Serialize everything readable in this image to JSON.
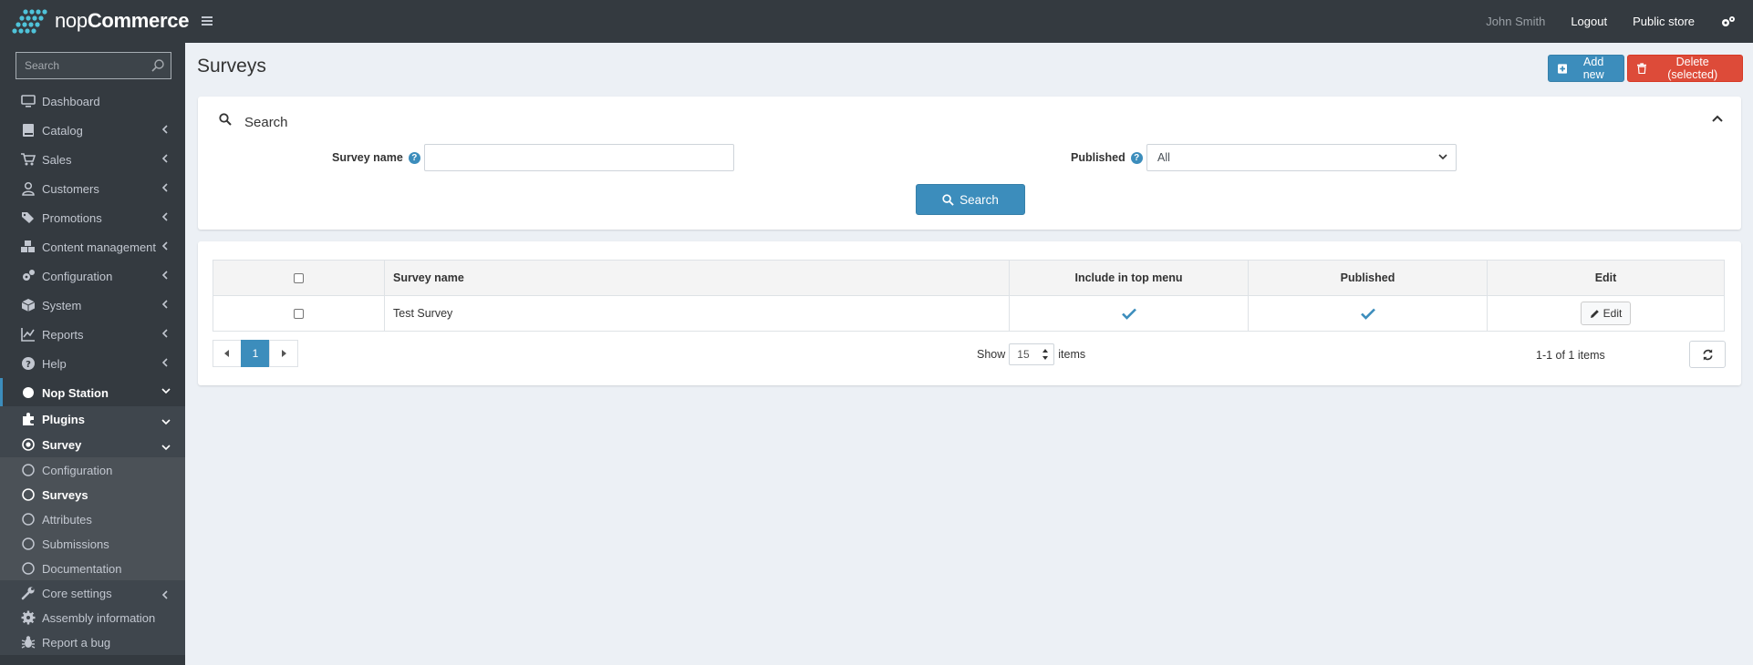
{
  "header": {
    "brand_light": "nop",
    "brand_bold": "Commerce",
    "user": "John Smith",
    "logout": "Logout",
    "public_store": "Public store"
  },
  "sidebar": {
    "search_placeholder": "Search",
    "items": [
      {
        "label": "Dashboard",
        "icon": "monitor-icon"
      },
      {
        "label": "Catalog",
        "icon": "book-icon"
      },
      {
        "label": "Sales",
        "icon": "cart-icon"
      },
      {
        "label": "Customers",
        "icon": "user-icon"
      },
      {
        "label": "Promotions",
        "icon": "tags-icon"
      },
      {
        "label": "Content management",
        "icon": "cubes-icon"
      },
      {
        "label": "Configuration",
        "icon": "gears-icon"
      },
      {
        "label": "System",
        "icon": "cube-icon"
      },
      {
        "label": "Reports",
        "icon": "chart-icon"
      },
      {
        "label": "Help",
        "icon": "question-icon"
      },
      {
        "label": "Nop Station",
        "icon": "circle-icon"
      },
      {
        "label": "Plugins",
        "icon": "puzzle-icon"
      },
      {
        "label": "Survey",
        "icon": "dot-circle-icon"
      },
      {
        "label": "Configuration",
        "icon": "circle-outline-icon"
      },
      {
        "label": "Surveys",
        "icon": "circle-outline-icon"
      },
      {
        "label": "Attributes",
        "icon": "circle-outline-icon"
      },
      {
        "label": "Submissions",
        "icon": "circle-outline-icon"
      },
      {
        "label": "Documentation",
        "icon": "circle-outline-icon"
      },
      {
        "label": "Core settings",
        "icon": "wrench-icon"
      },
      {
        "label": "Assembly information",
        "icon": "gear-icon"
      },
      {
        "label": "Report a bug",
        "icon": "bug-icon"
      }
    ]
  },
  "page": {
    "title": "Surveys",
    "add_new": "Add new",
    "delete_selected": "Delete (selected)"
  },
  "search": {
    "title": "Search",
    "survey_name_label": "Survey name",
    "survey_name_value": "",
    "published_label": "Published",
    "published_value": "All",
    "button": "Search"
  },
  "grid": {
    "columns": [
      "Survey name",
      "Include in top menu",
      "Published",
      "Edit"
    ],
    "rows": [
      {
        "name": "Test Survey",
        "include_in_top_menu": true,
        "published": true,
        "edit": "Edit"
      }
    ]
  },
  "pager": {
    "current_page": "1",
    "show": "Show",
    "page_size": "15",
    "items": "items",
    "info": "1-1 of 1 items"
  },
  "colors": {
    "primary": "#3c8dbc",
    "danger": "#dd4b39",
    "sidebar": "#343a40",
    "background": "#ecf0f5"
  }
}
